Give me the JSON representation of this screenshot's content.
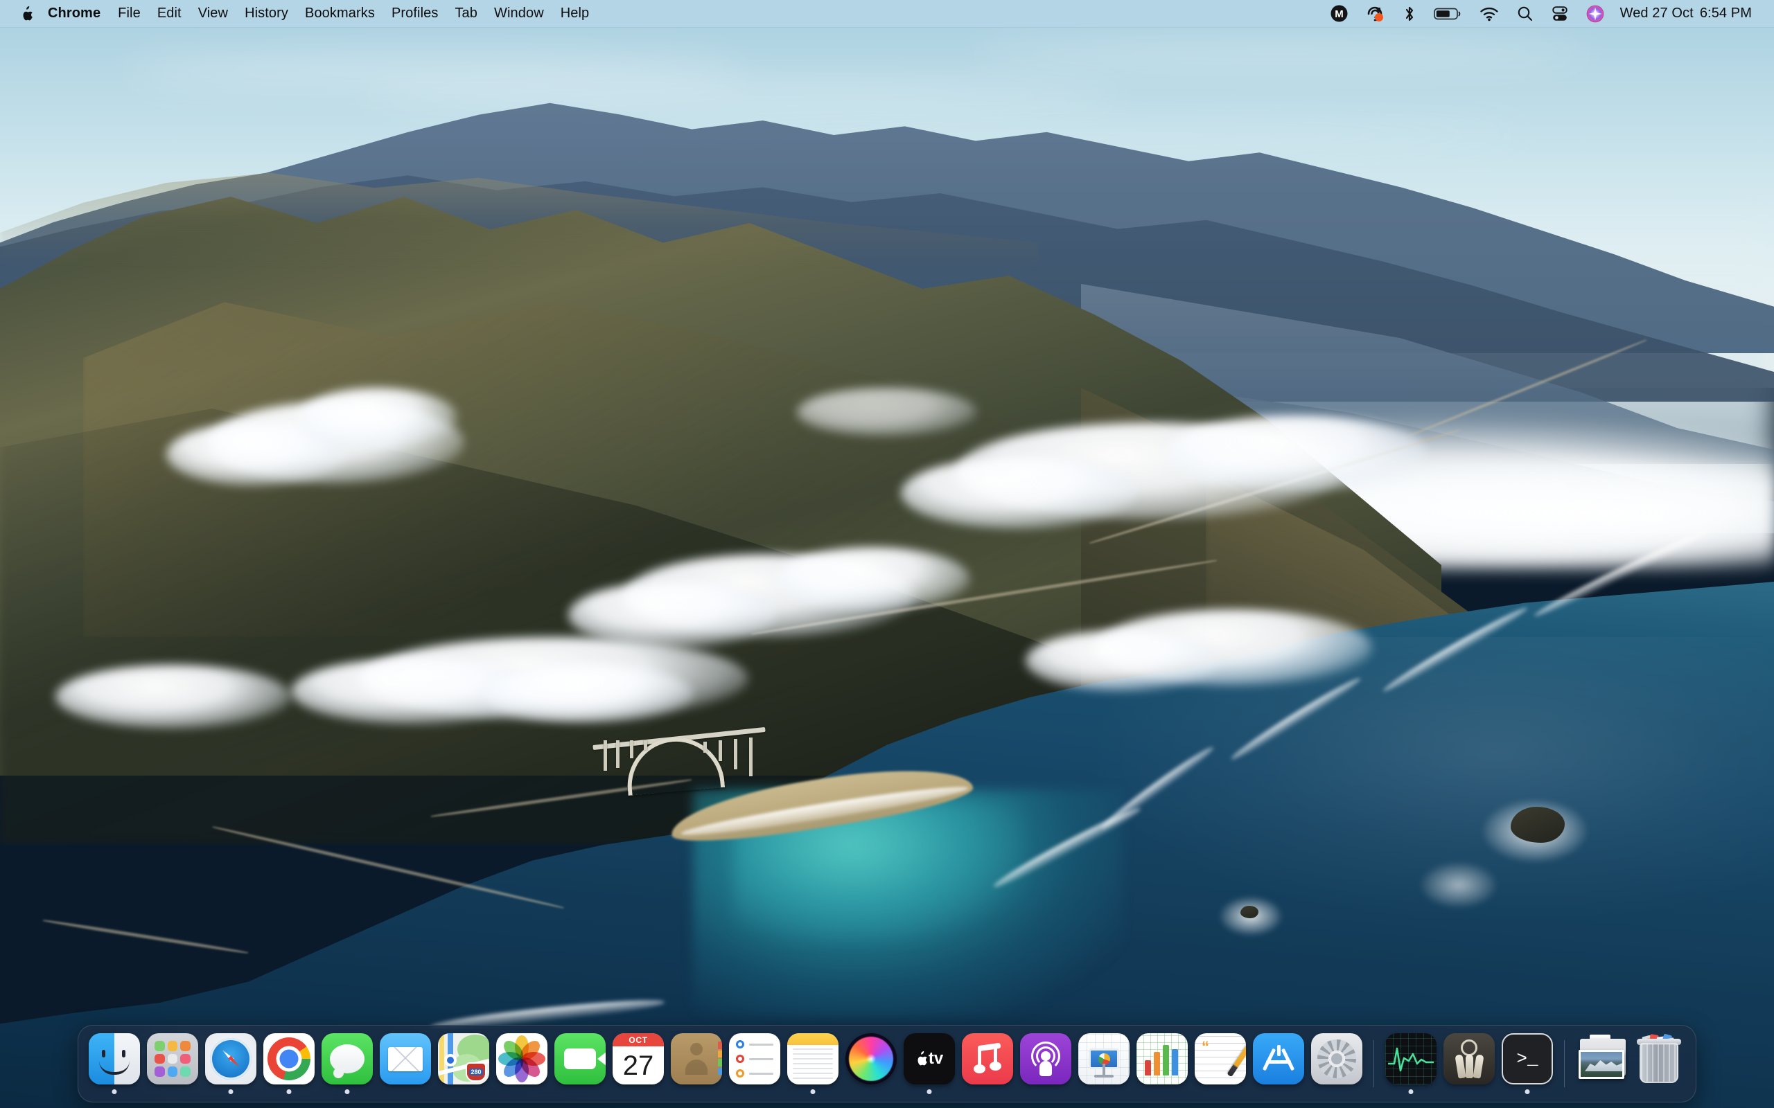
{
  "menubar": {
    "apple_icon": "apple-logo",
    "items": [
      {
        "label": "Chrome",
        "bold": true
      },
      {
        "label": "File",
        "bold": false
      },
      {
        "label": "Edit",
        "bold": false
      },
      {
        "label": "View",
        "bold": false
      },
      {
        "label": "History",
        "bold": false
      },
      {
        "label": "Bookmarks",
        "bold": false
      },
      {
        "label": "Profiles",
        "bold": false
      },
      {
        "label": "Tab",
        "bold": false
      },
      {
        "label": "Window",
        "bold": false
      },
      {
        "label": "Help",
        "bold": false
      }
    ],
    "status_icons": [
      {
        "name": "mega-m-icon",
        "glyph": "M"
      },
      {
        "name": "screen-recording-icon",
        "glyph": ""
      },
      {
        "name": "bluetooth-icon",
        "glyph": ""
      },
      {
        "name": "battery-icon",
        "glyph": ""
      },
      {
        "name": "wifi-icon",
        "glyph": ""
      },
      {
        "name": "spotlight-search-icon",
        "glyph": ""
      },
      {
        "name": "control-center-icon",
        "glyph": ""
      },
      {
        "name": "siri-icon",
        "glyph": ""
      }
    ],
    "clock": {
      "day": "Wed 27 Oct",
      "time": "6:54 PM"
    },
    "background_color": "#b4d6e6",
    "text_color": "#0d0d0f"
  },
  "desktop": {
    "wallpaper_name": "Big Sur Coastline",
    "sky_color": "#bcdce8",
    "ocean_color": "#14455f",
    "cove_color": "#34b0b2",
    "mountain_color": "#4e5540"
  },
  "dock": {
    "background_color": "#1c2c44",
    "items": [
      {
        "name": "finder",
        "label": "Finder",
        "running": true
      },
      {
        "name": "launchpad",
        "label": "Launchpad",
        "running": false
      },
      {
        "name": "safari",
        "label": "Safari",
        "running": true
      },
      {
        "name": "chrome",
        "label": "Google Chrome",
        "running": true
      },
      {
        "name": "messages",
        "label": "Messages",
        "running": true
      },
      {
        "name": "mail",
        "label": "Mail",
        "running": false
      },
      {
        "name": "maps",
        "label": "Maps",
        "running": false
      },
      {
        "name": "photos",
        "label": "Photos",
        "running": false
      },
      {
        "name": "facetime",
        "label": "FaceTime",
        "running": false
      },
      {
        "name": "calendar",
        "label": "Calendar",
        "running": false
      },
      {
        "name": "contacts",
        "label": "Contacts",
        "running": false
      },
      {
        "name": "reminders",
        "label": "Reminders",
        "running": false
      },
      {
        "name": "notes",
        "label": "Notes",
        "running": true
      },
      {
        "name": "siri",
        "label": "Siri",
        "running": false
      },
      {
        "name": "appletv",
        "label": "TV",
        "running": true
      },
      {
        "name": "music",
        "label": "Music",
        "running": false
      },
      {
        "name": "podcasts",
        "label": "Podcasts",
        "running": false
      },
      {
        "name": "keynote",
        "label": "Keynote",
        "running": false
      },
      {
        "name": "numbers",
        "label": "Numbers",
        "running": false
      },
      {
        "name": "pages",
        "label": "Pages",
        "running": false
      },
      {
        "name": "appstore",
        "label": "App Store",
        "running": false
      },
      {
        "name": "system-preferences",
        "label": "System Preferences",
        "running": false
      },
      {
        "name": "separator-1",
        "label": "",
        "running": false
      },
      {
        "name": "activity-monitor",
        "label": "Activity Monitor",
        "running": true
      },
      {
        "name": "keychain-access",
        "label": "Keychain Access",
        "running": false
      },
      {
        "name": "terminal",
        "label": "Terminal",
        "running": true
      },
      {
        "name": "separator-2",
        "label": "",
        "running": false
      },
      {
        "name": "downloads-stack",
        "label": "Downloads",
        "running": false
      },
      {
        "name": "trash",
        "label": "Trash",
        "running": false
      }
    ],
    "calendar_month": "OCT",
    "calendar_day": "27",
    "appletv_label": "tv",
    "maps_route_shield": "280",
    "terminal_prompt": ">_"
  }
}
